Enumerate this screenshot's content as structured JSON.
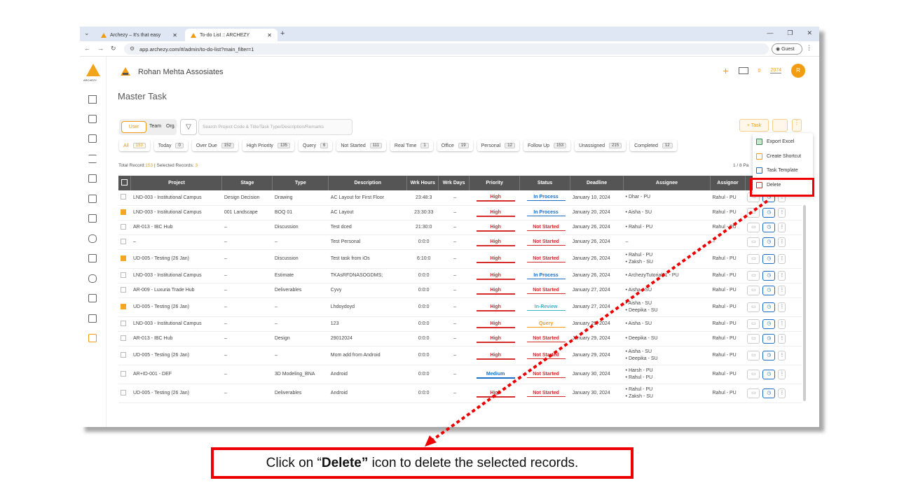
{
  "browser": {
    "tabs": [
      {
        "title": "Archezy – It's that easy"
      },
      {
        "title": "To-do List :: ARCHEZY"
      }
    ],
    "url": "app.archezy.com/#/admin/to-do-list?main_filter=1",
    "guest_label": "Guest"
  },
  "app": {
    "brand": "ARCHEZY",
    "company": "Rohan Mehta Assosiates",
    "notif_count": "0",
    "points": "2074",
    "avatar_letter": "R"
  },
  "page": {
    "title": "Master Task",
    "toggle": {
      "user": "User",
      "team": "Team",
      "org": "Org."
    },
    "search_placeholder": "Search Project Code & Title/Task Type/Description/Remarks",
    "task_button": "+ Task",
    "filters": [
      {
        "label": "All",
        "count": "153"
      },
      {
        "label": "Today",
        "count": "0"
      },
      {
        "label": "Over Due",
        "count": "152"
      },
      {
        "label": "High Priority",
        "count": "135"
      },
      {
        "label": "Query",
        "count": "6"
      },
      {
        "label": "Not Started",
        "count": "111"
      },
      {
        "label": "Real Time",
        "count": "1"
      },
      {
        "label": "Office",
        "count": "19"
      },
      {
        "label": "Personal",
        "count": "12"
      },
      {
        "label": "Follow Up",
        "count": "153"
      },
      {
        "label": "Unassigned",
        "count": "215"
      },
      {
        "label": "Completed",
        "count": "12"
      }
    ],
    "total_label": "Total Record:",
    "total_count": "153",
    "selected_label": " | Selected Records: ",
    "selected_count": "3",
    "pager": "1 / 8 Pa"
  },
  "table": {
    "columns": [
      "Project",
      "Stage",
      "Type",
      "Description",
      "Wrk Hours",
      "Wrk Days",
      "Priority",
      "Status",
      "Deadline",
      "Assignee",
      "Assignor"
    ],
    "rows": [
      {
        "checked": false,
        "project": "LND-003 - Institutional Campus",
        "stage": "Design Decision",
        "type": "Drawing",
        "desc": "AC Layout for First Floor",
        "hours": "23:48:3",
        "days": "–",
        "priority": "High",
        "status": "In Process",
        "deadline": "January 10, 2024",
        "assignee": [
          "Dhar - PU"
        ],
        "assignor": "Rahul - PU"
      },
      {
        "checked": true,
        "project": "LND-003 - Institutional Campus",
        "stage": "001 Landscape",
        "type": "BOQ 01",
        "desc": "AC Layout",
        "hours": "23:30:33",
        "days": "–",
        "priority": "High",
        "status": "In Process",
        "deadline": "January 20, 2024",
        "assignee": [
          "Aisha - SU"
        ],
        "assignor": "Rahul - PU"
      },
      {
        "checked": false,
        "project": "AR-013 - IBC Hub",
        "stage": "–",
        "type": "Discussion",
        "desc": "Test dced",
        "hours": "21:30:0",
        "days": "–",
        "priority": "High",
        "status": "Not Started",
        "deadline": "January 26, 2024",
        "assignee": [
          "Rahul - PU"
        ],
        "assignor": "Rahul - PU"
      },
      {
        "checked": false,
        "project": "–",
        "stage": "–",
        "type": "–",
        "desc": "Test Personal",
        "hours": "0:0:0",
        "days": "–",
        "priority": "High",
        "status": "Not Started",
        "deadline": "January 26, 2024",
        "assignee": [
          "–"
        ],
        "assignor": "–"
      },
      {
        "checked": true,
        "project": "UD-005 - Testing (26 Jan)",
        "stage": "–",
        "type": "Discussion",
        "desc": "Test task from iOs",
        "hours": "6:10:0",
        "days": "–",
        "priority": "High",
        "status": "Not Started",
        "deadline": "January 26, 2024",
        "assignee": [
          "Rahul - PU",
          "Zaksh - SU"
        ],
        "assignor": "Rahul - PU"
      },
      {
        "checked": false,
        "project": "LND-003 - Institutional Campus",
        "stage": "–",
        "type": "Estimate",
        "desc": "TKAsRFDNASOGDMS;",
        "hours": "0:0:0",
        "days": "–",
        "priority": "High",
        "status": "In Process",
        "deadline": "January 26, 2024",
        "assignee": [
          "ArchezyTutorial01 - PU"
        ],
        "assignor": "Rahul - PU"
      },
      {
        "checked": false,
        "project": "AR-009 - Luxuria Trade Hub",
        "stage": "–",
        "type": "Deliverables",
        "desc": "Cyvy",
        "hours": "0:0:0",
        "days": "–",
        "priority": "High",
        "status": "Not Started",
        "deadline": "January 27, 2024",
        "assignee": [
          "Aisha - SU"
        ],
        "assignor": "Rahul - PU"
      },
      {
        "checked": true,
        "project": "UD-005 - Testing (26 Jan)",
        "stage": "–",
        "type": "–",
        "desc": "Lhdoydoyd",
        "hours": "0:0:0",
        "days": "–",
        "priority": "High",
        "status": "In-Review",
        "deadline": "January 27, 2024",
        "assignee": [
          "Aisha - SU",
          "Deepika - SU"
        ],
        "assignor": "Rahul - PU"
      },
      {
        "checked": false,
        "project": "LND-003 - Institutional Campus",
        "stage": "–",
        "type": "–",
        "desc": "123",
        "hours": "0:0:0",
        "days": "–",
        "priority": "High",
        "status": "Query",
        "deadline": "January 29, 2024",
        "assignee": [
          "Aisha - SU"
        ],
        "assignor": "Rahul - PU"
      },
      {
        "checked": false,
        "project": "AR-013 - IBC Hub",
        "stage": "–",
        "type": "Design",
        "desc": "29012024",
        "hours": "0:0:0",
        "days": "–",
        "priority": "High",
        "status": "Not Started",
        "deadline": "January 29, 2024",
        "assignee": [
          "Deepika - SU"
        ],
        "assignor": "Rahul - PU"
      },
      {
        "checked": false,
        "project": "UD-005 - Testing (26 Jan)",
        "stage": "–",
        "type": "–",
        "desc": "Mom add from Android",
        "hours": "0:0:0",
        "days": "–",
        "priority": "High",
        "status": "Not Started",
        "deadline": "January 29, 2024",
        "assignee": [
          "Aisha - SU",
          "Deepika - SU"
        ],
        "assignor": "Rahul - PU"
      },
      {
        "checked": false,
        "project": "AR+ID-001 - DEF",
        "stage": "–",
        "type": "3D Modeling_BNA",
        "desc": "Android",
        "hours": "0:0:0",
        "days": "–",
        "priority": "Medium",
        "status": "Not Started",
        "deadline": "January 30, 2024",
        "assignee": [
          "Harsh - PU",
          "Rahul - PU"
        ],
        "assignor": "Rahul - PU"
      },
      {
        "checked": false,
        "project": "UD-005 - Testing (26 Jan)",
        "stage": "–",
        "type": "Deliverables",
        "desc": "Android",
        "hours": "0:0:0",
        "days": "–",
        "priority": "High",
        "status": "Not Started",
        "deadline": "January 30, 2024",
        "assignee": [
          "Rahul - PU",
          "Zaksh - SU"
        ],
        "assignor": "Rahul - PU"
      }
    ]
  },
  "dropdown": {
    "items": [
      "Export Excel",
      "Create Shortcut",
      "Task Template",
      "Delete"
    ]
  },
  "callout": {
    "prefix": "Click on “",
    "bold": "Delete”",
    "suffix": " icon to delete the selected records."
  },
  "colors": {
    "accent": "#f39c12",
    "highlight": "#e00000",
    "high": "#d62b2b",
    "process": "#1a6fc4"
  }
}
